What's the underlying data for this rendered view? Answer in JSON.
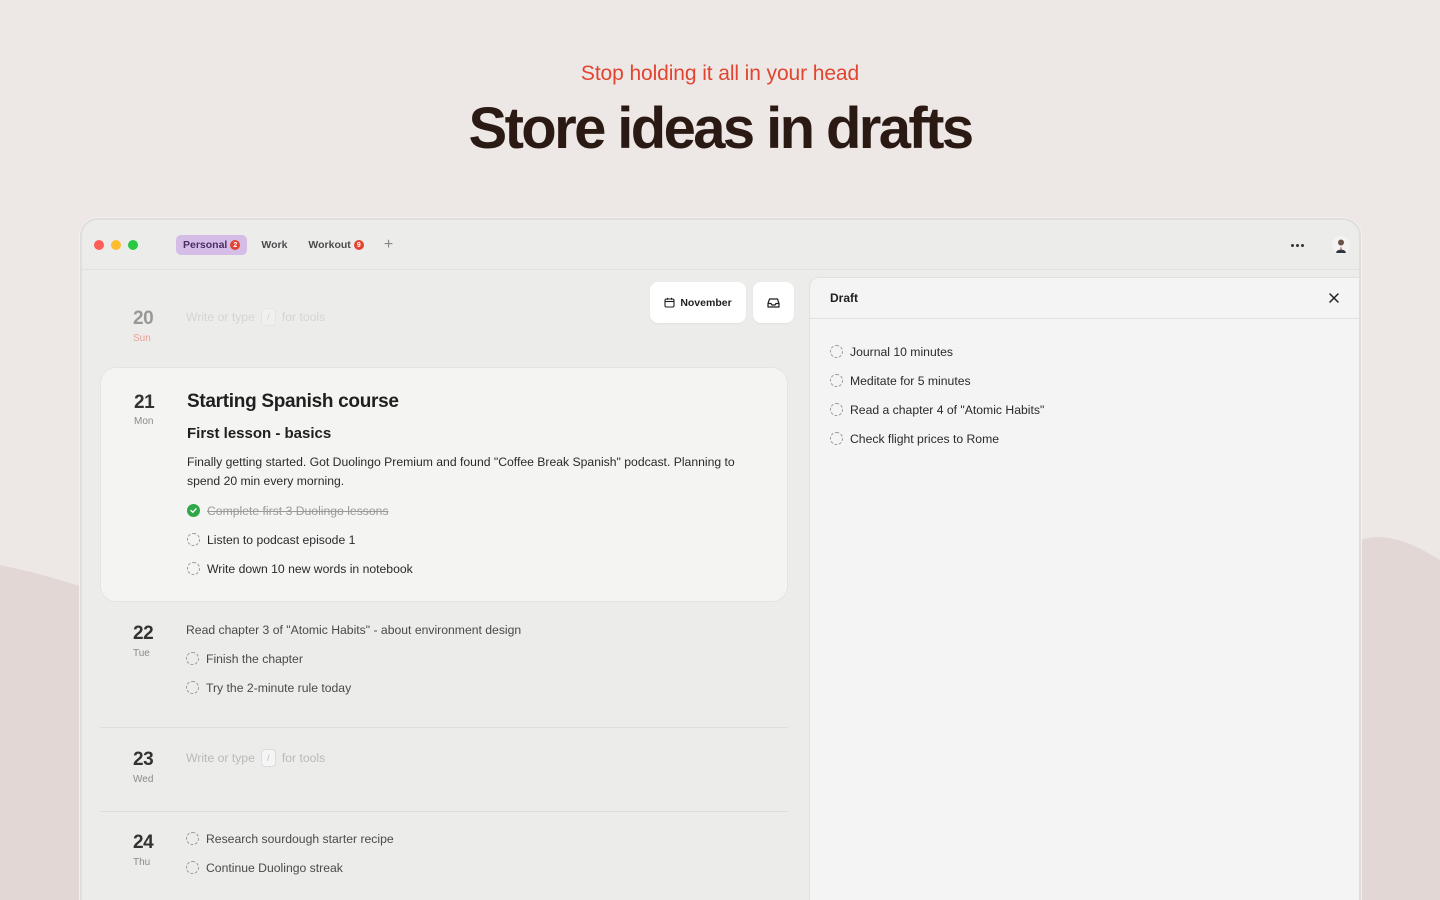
{
  "hero": {
    "kicker": "Stop holding it all in your head",
    "title": "Store ideas in drafts"
  },
  "tabs": [
    {
      "label": "Personal",
      "badge": "2",
      "active": true
    },
    {
      "label": "Work",
      "badge": "",
      "active": false
    },
    {
      "label": "Workout",
      "badge": "9",
      "active": false
    }
  ],
  "toolbar": {
    "month_label": "November"
  },
  "journal": {
    "placeholder_before": "Write or type",
    "placeholder_key": "/",
    "placeholder_after": "for tools",
    "days": [
      {
        "num": "20",
        "weekday": "Sun"
      },
      {
        "num": "21",
        "weekday": "Mon",
        "title": "Starting Spanish course",
        "subtitle": "First lesson - basics",
        "text": "Finally getting started. Got Duolingo Premium and found \"Coffee Break Spanish\" podcast. Planning to spend 20 min every morning.",
        "todos": [
          {
            "label": "Complete first 3 Duolingo lessons",
            "done": true
          },
          {
            "label": "Listen to podcast episode 1",
            "done": false
          },
          {
            "label": "Write down 10 new words in notebook",
            "done": false
          }
        ]
      },
      {
        "num": "22",
        "weekday": "Tue",
        "text": "Read chapter 3 of \"Atomic Habits\" - about environment design",
        "todos": [
          {
            "label": "Finish the chapter",
            "done": false
          },
          {
            "label": "Try the 2-minute rule today",
            "done": false
          }
        ]
      },
      {
        "num": "23",
        "weekday": "Wed"
      },
      {
        "num": "24",
        "weekday": "Thu",
        "todos": [
          {
            "label": "Research sourdough starter recipe",
            "done": false
          },
          {
            "label": "Continue Duolingo streak",
            "done": false
          }
        ]
      }
    ]
  },
  "draft": {
    "title": "Draft",
    "items": [
      "Journal 10 minutes",
      "Meditate for 5 minutes",
      "Read a chapter 4 of \"Atomic Habits\"",
      "Check flight prices to Rome"
    ]
  },
  "colors": {
    "accent": "#e2452f",
    "tab_active_bg": "#d5bde8",
    "done_green": "#2fa84a",
    "weekday_red": "#e2452f"
  }
}
